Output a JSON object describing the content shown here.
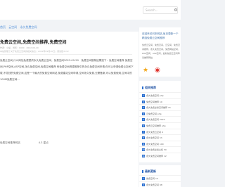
{
  "header": {
    "search_placeholder": "Search..."
  },
  "breadcrumb": [
    "首页",
    "云空间",
    "永久免费空间"
  ],
  "article": {
    "title": "免费云空间,免费空间推荐,免费空间",
    "meta1": "作者：小编 · 浏览：1000 · 2022-09-20",
    "meta2": "本站整理了关于免费云空间的相关信息 | 2022年09月20日 | 阅读数3132",
    "body": "免费云空间,什么网站免费提供永久免费云空间，免费空间2023-09-20　免费空间推荐结果如下：免费空间推荐 免费空间,PHP空间,ASP空间,永久免费空间,免费空间推荐 有免费空间资源推荐中的永久免费空间申请,你可以申请免费云空间下载,不花钱的免费空间,这是一个最大的免费空间网站,免费建站空间申请,空间永久免费,无需备案,可以免费使用,空间中的100M免费空间...",
    "tags": [
      "免费空间推荐网站",
      "4.3 星点"
    ]
  },
  "side_promo": {
    "title": "欢迎来访问本网站,每日更新一个精选免费云空间推荐",
    "desc": "免费云空间，免费空间，云空间，免费空间推荐，永久免费空间，免费网站空间，PHP空间，ASP空间，最新免费云空间申请推荐网站"
  },
  "side_hot": {
    "title": "相关推荐",
    "items": [
      "永久免费空间 php",
      "免费空间推荐 10",
      "永久免费虚拟空间推荐 15",
      "云免费空间 php",
      "永久免费空间 2023",
      "免费云空间推荐 php",
      "永久免费云空间 9",
      "永久免费空间 hh",
      "永久免费空间 100",
      "永久免费虚拟主机 50",
      "永久免费空间推荐 12"
    ]
  },
  "side_new": {
    "title": "最新更新",
    "items": [
      "免费空间 10",
      "永久免费空间 98"
    ]
  },
  "colors": {
    "accent": "#2a6fd0",
    "background": "#f1f3f6"
  }
}
